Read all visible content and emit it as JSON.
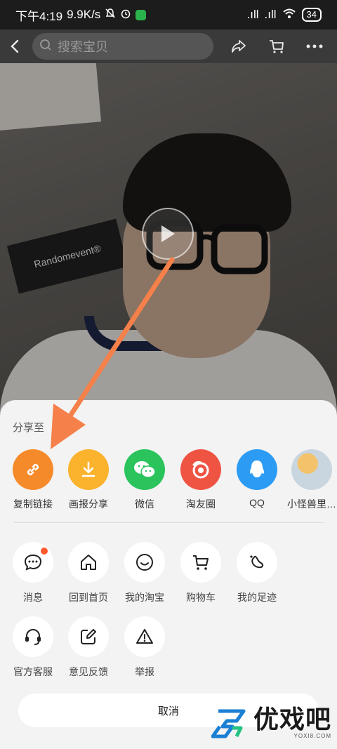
{
  "status_bar": {
    "time": "下午4:19",
    "net_speed": "9.9K/s",
    "signal1": ".ıll",
    "signal2": ".ıll",
    "battery": "34"
  },
  "header": {
    "search_placeholder": "搜索宝贝"
  },
  "sticker_text": "Randomevent®",
  "share_sheet": {
    "title": "分享至",
    "share_targets": [
      {
        "label": "复制链接",
        "icon": "link-icon",
        "color": "#f58a2a"
      },
      {
        "label": "画报分享",
        "icon": "download-icon",
        "color": "#fbb22d"
      },
      {
        "label": "微信",
        "icon": "wechat-icon",
        "color": "#2ac35c"
      },
      {
        "label": "淘友圈",
        "icon": "taoyou-icon",
        "color": "#ef5443"
      },
      {
        "label": "QQ",
        "icon": "qq-icon",
        "color": "#2b9bf3"
      },
      {
        "label": "小怪兽里…",
        "icon": "avatar-icon",
        "color": "#9fb7c9"
      }
    ],
    "actions_row1": [
      {
        "label": "消息",
        "icon": "message-icon"
      },
      {
        "label": "回到首页",
        "icon": "home-icon"
      },
      {
        "label": "我的淘宝",
        "icon": "smile-icon"
      },
      {
        "label": "购物车",
        "icon": "cart-icon"
      },
      {
        "label": "我的足迹",
        "icon": "footprint-icon"
      }
    ],
    "actions_row2": [
      {
        "label": "官方客服",
        "icon": "headset-icon"
      },
      {
        "label": "意见反馈",
        "icon": "edit-icon"
      },
      {
        "label": "举报",
        "icon": "warning-icon"
      }
    ],
    "cancel_label": "取消"
  },
  "watermark": {
    "text": "优戏吧",
    "sub": "YOXI8.COM"
  },
  "colors": {
    "arrow": "#f5804a",
    "sheet_bg": "#f3f3f3"
  }
}
